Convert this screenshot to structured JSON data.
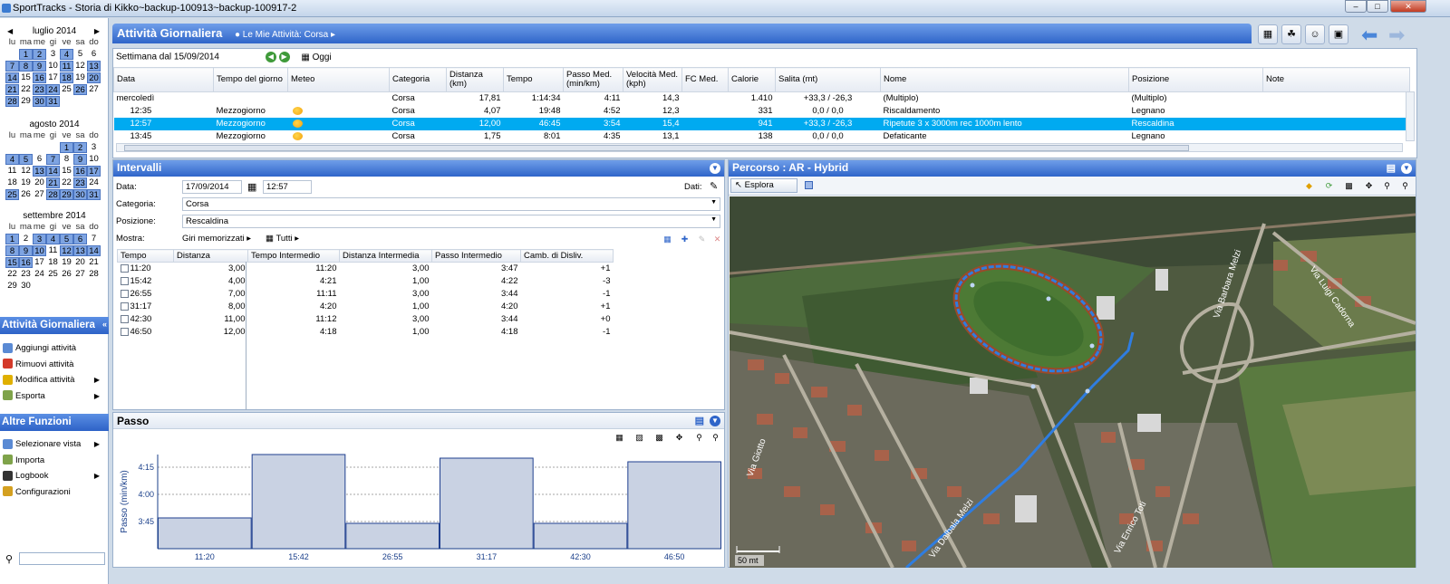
{
  "window": {
    "title": "SportTracks - Storia di Kikko~backup-100913~backup-100917-2"
  },
  "calendars": [
    {
      "title": "luglio 2014",
      "days": [
        "lu",
        "ma",
        "me",
        "gi",
        "ve",
        "sa",
        "do"
      ],
      "cells": [
        "",
        "1",
        "2",
        "3",
        "4",
        "5",
        "6",
        "7",
        "8",
        "9",
        "10",
        "11",
        "12",
        "13",
        "14",
        "15",
        "16",
        "17",
        "18",
        "19",
        "20",
        "21",
        "22",
        "23",
        "24",
        "25",
        "26",
        "27",
        "28",
        "29",
        "30",
        "31",
        "",
        "",
        ""
      ],
      "highlight": [
        "1",
        "2",
        "4",
        "7",
        "8",
        "9",
        "11",
        "13",
        "14",
        "16",
        "18",
        "20",
        "21",
        "23",
        "24",
        "26",
        "28",
        "30",
        "31"
      ]
    },
    {
      "title": "agosto 2014",
      "days": [
        "lu",
        "ma",
        "me",
        "gi",
        "ve",
        "sa",
        "do"
      ],
      "cells": [
        "",
        "",
        "",
        "",
        "1",
        "2",
        "3",
        "4",
        "5",
        "6",
        "7",
        "8",
        "9",
        "10",
        "11",
        "12",
        "13",
        "14",
        "15",
        "16",
        "17",
        "18",
        "19",
        "20",
        "21",
        "22",
        "23",
        "24",
        "25",
        "26",
        "27",
        "28",
        "29",
        "30",
        "31"
      ],
      "highlight": [
        "1",
        "2",
        "4",
        "5",
        "7",
        "9",
        "13",
        "14",
        "16",
        "17",
        "21",
        "23",
        "25",
        "28",
        "29",
        "30",
        "31"
      ]
    },
    {
      "title": "settembre 2014",
      "days": [
        "lu",
        "ma",
        "me",
        "gi",
        "ve",
        "sa",
        "do"
      ],
      "cells": [
        "1",
        "2",
        "3",
        "4",
        "5",
        "6",
        "7",
        "8",
        "9",
        "10",
        "11",
        "12",
        "13",
        "14",
        "15",
        "16",
        "17",
        "18",
        "19",
        "20",
        "21",
        "22",
        "23",
        "24",
        "25",
        "26",
        "27",
        "28",
        "29",
        "30",
        "",
        "",
        "",
        "",
        ""
      ],
      "highlight": [
        "1",
        "3",
        "4",
        "5",
        "6",
        "8",
        "9",
        "10",
        "12",
        "13",
        "14",
        "15",
        "16"
      ]
    }
  ],
  "sidebar": {
    "activity_title": "Attività Giornaliera",
    "activity_items": [
      {
        "label": "Aggiungi attività",
        "icon": "add-activity-icon",
        "sub": false
      },
      {
        "label": "Rimuovi attività",
        "icon": "remove-x-icon",
        "sub": false
      },
      {
        "label": "Modifica attività",
        "icon": "pencil-icon",
        "sub": true
      },
      {
        "label": "Esporta",
        "icon": "export-icon",
        "sub": true
      }
    ],
    "other_title": "Altre Funzioni",
    "other_items": [
      {
        "label": "Selezionare vista",
        "icon": "view-icon",
        "sub": true
      },
      {
        "label": "Importa",
        "icon": "import-icon",
        "sub": false
      },
      {
        "label": "Logbook",
        "icon": "logbook-icon",
        "sub": true
      },
      {
        "label": "Configurazioni",
        "icon": "gear-icon",
        "sub": false
      }
    ]
  },
  "header": {
    "title": "Attività Giornaliera",
    "crumb": "Le Mie Attività: Corsa"
  },
  "week": {
    "label": "Settimana dal 15/09/2014",
    "today": "Oggi"
  },
  "activities": {
    "columns": [
      "Data",
      "Tempo del giorno",
      "Meteo",
      "Categoria",
      "Distanza (km)",
      "Tempo",
      "Passo Med. (min/km)",
      "Velocità Med. (kph)",
      "FC Med.",
      "Calorie",
      "Salita (mt)",
      "Nome",
      "Posizione",
      "Note"
    ],
    "rows": [
      {
        "data": "mercoledì",
        "tod": "",
        "meteo": false,
        "cat": "Corsa",
        "dist": "17,81",
        "tempo": "1:14:34",
        "passo": "4:11",
        "vel": "14,3",
        "fc": "",
        "cal": "1.410",
        "salita": "+33,3 / -26,3",
        "nome": "(Multiplo)",
        "pos": "(Multiplo)",
        "note": "",
        "sel": false
      },
      {
        "data": "12:35",
        "tod": "Mezzogiorno",
        "meteo": true,
        "cat": "Corsa",
        "dist": "4,07",
        "tempo": "19:48",
        "passo": "4:52",
        "vel": "12,3",
        "fc": "",
        "cal": "331",
        "salita": "0,0 / 0,0",
        "nome": "Riscaldamento",
        "pos": "Legnano",
        "note": "",
        "sel": false
      },
      {
        "data": "12:57",
        "tod": "Mezzogiorno",
        "meteo": true,
        "cat": "Corsa",
        "dist": "12,00",
        "tempo": "46:45",
        "passo": "3:54",
        "vel": "15,4",
        "fc": "",
        "cal": "941",
        "salita": "+33,3 / -26,3",
        "nome": "Ripetute 3 x 3000m rec 1000m lento",
        "pos": "Rescaldina",
        "note": "",
        "sel": true
      },
      {
        "data": "13:45",
        "tod": "Mezzogiorno",
        "meteo": true,
        "cat": "Corsa",
        "dist": "1,75",
        "tempo": "8:01",
        "passo": "4:35",
        "vel": "13,1",
        "fc": "",
        "cal": "138",
        "salita": "0,0 / 0,0",
        "nome": "Defaticante",
        "pos": "Legnano",
        "note": "",
        "sel": false
      }
    ]
  },
  "intervals": {
    "title": "Intervalli",
    "data_label": "Data:",
    "date": "17/09/2014",
    "time": "12:57",
    "dati_label": "Dati:",
    "cat_label": "Categoria:",
    "cat": "Corsa",
    "pos_label": "Posizione:",
    "pos": "Rescaldina",
    "show_label": "Mostra:",
    "show_value": "Giri memorizzati",
    "filter": "Tutti",
    "columns": [
      "Tempo",
      "Distanza",
      "Tempo Intermedio",
      "Distanza Intermedia",
      "Passo Intermedio",
      "Camb. di Disliv."
    ],
    "rows": [
      [
        "11:20",
        "3,00",
        "11:20",
        "3,00",
        "3:47",
        "+1"
      ],
      [
        "15:42",
        "4,00",
        "4:21",
        "1,00",
        "4:22",
        "-3"
      ],
      [
        "26:55",
        "7,00",
        "11:11",
        "3,00",
        "3:44",
        "-1"
      ],
      [
        "31:17",
        "8,00",
        "4:20",
        "1,00",
        "4:20",
        "+1"
      ],
      [
        "42:30",
        "11,00",
        "11:12",
        "3,00",
        "3:44",
        "+0"
      ],
      [
        "46:50",
        "12,00",
        "4:18",
        "1,00",
        "4:18",
        "-1"
      ]
    ]
  },
  "pace": {
    "title": "Passo"
  },
  "chart_data": {
    "type": "bar",
    "title": "Passo",
    "ylabel": "Passo (min/km)",
    "categories": [
      "11:20",
      "15:42",
      "26:55",
      "31:17",
      "42:30",
      "46:50"
    ],
    "values": [
      227,
      262,
      224,
      260,
      224,
      258
    ],
    "value_units": "seconds per km",
    "ytick_labels": [
      "3:45",
      "4:00",
      "4:15"
    ],
    "ytick_values": [
      225,
      240,
      255
    ],
    "ylim": [
      210,
      262
    ],
    "grid": true
  },
  "map": {
    "title": "Percorso : AR - Hybrid",
    "tool": "Esplora",
    "scale": "50 mt",
    "streets": [
      "Via Barbara Melzi",
      "Via Luigi Cadorna",
      "Via Giotto",
      "Via Dalbala Melzi",
      "Via Enrico Toti"
    ]
  },
  "colors": {
    "titlebar": "#2f65c9",
    "selected_row": "#00aaf0",
    "calendar_highlight": "#7ea4e2",
    "route": "#2f7de0"
  }
}
